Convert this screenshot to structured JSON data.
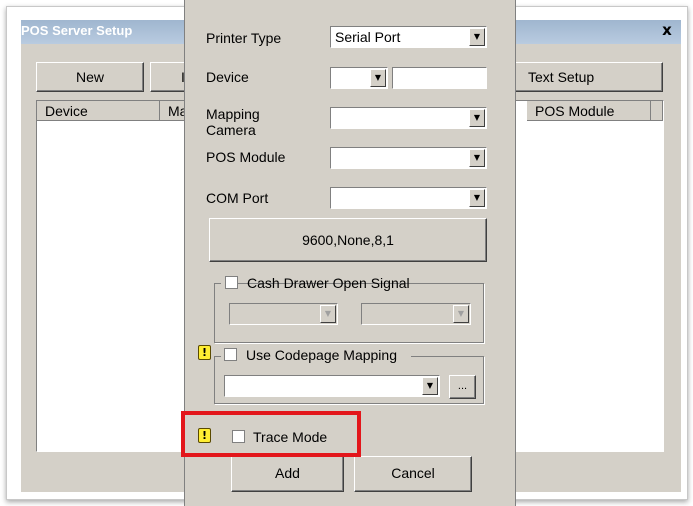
{
  "window": {
    "title": "POS Server Setup",
    "close_glyph": "x"
  },
  "toolbar": {
    "new_label": "New",
    "text_setup_label": "Text Setup",
    "partial_char": "I"
  },
  "list": {
    "columns": [
      "Device",
      "Ma",
      "POS Module"
    ]
  },
  "dialog": {
    "printer_type_label": "Printer Type",
    "printer_type_value": "Serial Port",
    "device_label": "Device",
    "mapping_camera_label_1": "Mapping",
    "mapping_camera_label_2": "Camera",
    "pos_module_label": "POS Module",
    "com_port_label": "COM Port",
    "serial_settings_button": "9600,None,8,1",
    "cash_drawer_label": "Cash Drawer Open Signal",
    "codepage_label": "Use Codepage Mapping",
    "browse_label": "...",
    "trace_mode_label": "Trace Mode",
    "add_label": "Add",
    "cancel_label": "Cancel",
    "warn_glyph": "!"
  },
  "colors": {
    "highlight": "#e3161b",
    "warning": "#ffee33",
    "face": "#d4d0c8"
  },
  "icons": [
    "close-icon",
    "dropdown-arrow-icon",
    "warning-icon"
  ]
}
